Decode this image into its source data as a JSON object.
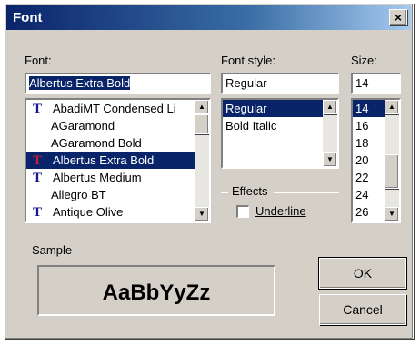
{
  "window": {
    "title": "Font",
    "close_glyph": "×"
  },
  "font": {
    "label": "Font:",
    "value": "Albertus Extra Bold",
    "items": [
      {
        "label": "AbadiMT Condensed Li",
        "icon": "truetype-icon",
        "selected": false
      },
      {
        "label": "AGaramond",
        "icon": "",
        "selected": false
      },
      {
        "label": "AGaramond Bold",
        "icon": "",
        "selected": false
      },
      {
        "label": "Albertus Extra Bold",
        "icon": "truetype-icon",
        "selected": true
      },
      {
        "label": "Albertus Medium",
        "icon": "truetype-icon",
        "selected": false
      },
      {
        "label": "Allegro BT",
        "icon": "",
        "selected": false
      },
      {
        "label": "Antique Olive",
        "icon": "truetype-icon",
        "selected": false
      }
    ]
  },
  "style": {
    "label": "Font style:",
    "value": "Regular",
    "items": [
      {
        "label": "Regular",
        "selected": true
      },
      {
        "label": "Bold Italic",
        "selected": false
      }
    ]
  },
  "size": {
    "label": "Size:",
    "value": "14",
    "items": [
      {
        "label": "14",
        "selected": true
      },
      {
        "label": "16",
        "selected": false
      },
      {
        "label": "18",
        "selected": false
      },
      {
        "label": "20",
        "selected": false
      },
      {
        "label": "22",
        "selected": false
      },
      {
        "label": "24",
        "selected": false
      },
      {
        "label": "26",
        "selected": false
      }
    ]
  },
  "effects": {
    "label": "Effects",
    "underline_label": "Underline",
    "underline_checked": false
  },
  "sample": {
    "label": "Sample",
    "text": "AaBbYyZz"
  },
  "buttons": {
    "ok": "OK",
    "cancel": "Cancel"
  },
  "icons": {
    "truetype_glyph": "T"
  },
  "colors": {
    "selection": "#0a246a",
    "title_start": "#0a246a",
    "title_end": "#a6caf0",
    "face": "#d4d0c8"
  }
}
